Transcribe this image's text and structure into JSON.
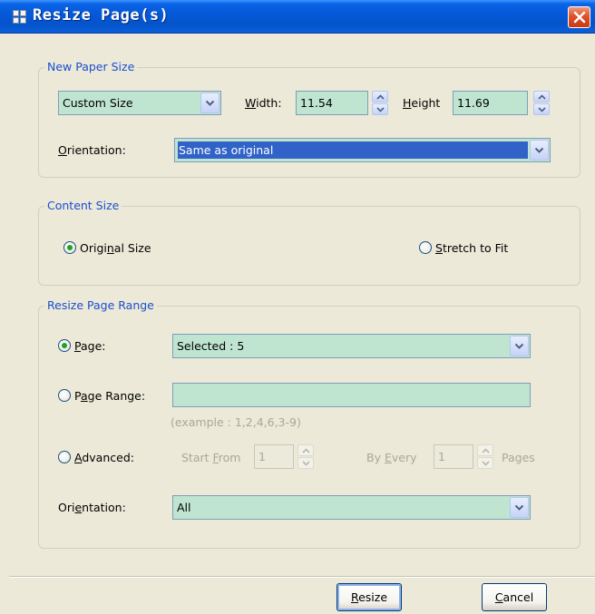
{
  "window": {
    "title": "Resize Page(s)"
  },
  "paper_size": {
    "legend": "New Paper Size",
    "size_select": "Custom Size",
    "width_label": "Width:",
    "width_value": "11.54",
    "height_label": "Height",
    "height_value": "11.69",
    "orientation_label": "Orientation:",
    "orientation_value": "Same as original"
  },
  "content_size": {
    "legend": "Content Size",
    "original_label": "Original Size",
    "stretch_label": "Stretch to Fit",
    "selected": "original"
  },
  "page_range": {
    "legend": "Resize Page Range",
    "page_label": "Page:",
    "page_value": "Selected : 5",
    "range_label": "Page Range:",
    "range_value": "",
    "range_example": "(example : 1,2,4,6,3-9)",
    "advanced_label": "Advanced:",
    "start_from_label": "Start From",
    "start_from_value": "1",
    "by_every_label": "By Every",
    "by_every_value": "1",
    "pages_label": "Pages",
    "orientation_label": "Orientation:",
    "orientation_value": "All",
    "selected": "page"
  },
  "buttons": {
    "resize": "Resize",
    "cancel": "Cancel"
  }
}
